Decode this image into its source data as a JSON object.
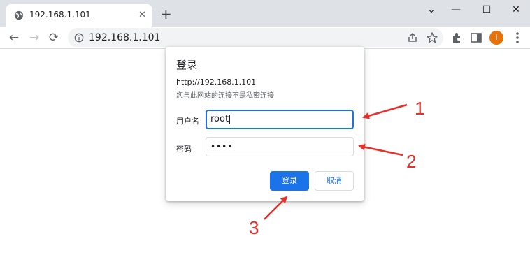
{
  "tab": {
    "title": "192.168.1.101",
    "close": "✕",
    "new_tab": "+"
  },
  "window_controls": {
    "minimize": "—",
    "maximize": "☐",
    "close": "✕",
    "chevron": "⌄"
  },
  "toolbar": {
    "url": "192.168.1.101",
    "back": "←",
    "forward": "→",
    "reload": "⟳"
  },
  "profile": {
    "initial": "I",
    "color": "#e8710a"
  },
  "dialog": {
    "title": "登录",
    "url": "http://192.168.1.101",
    "warning": "您与此网站的连接不是私密连接",
    "username_label": "用户名",
    "username_value": "root",
    "password_label": "密码",
    "password_value": "••••",
    "ok_label": "登录",
    "cancel_label": "取消"
  },
  "annotations": {
    "one": "1",
    "two": "2",
    "three": "3",
    "color": "#e8302a"
  },
  "colors": {
    "accent": "#1a73e8",
    "tabstrip": "#dee1e6"
  }
}
